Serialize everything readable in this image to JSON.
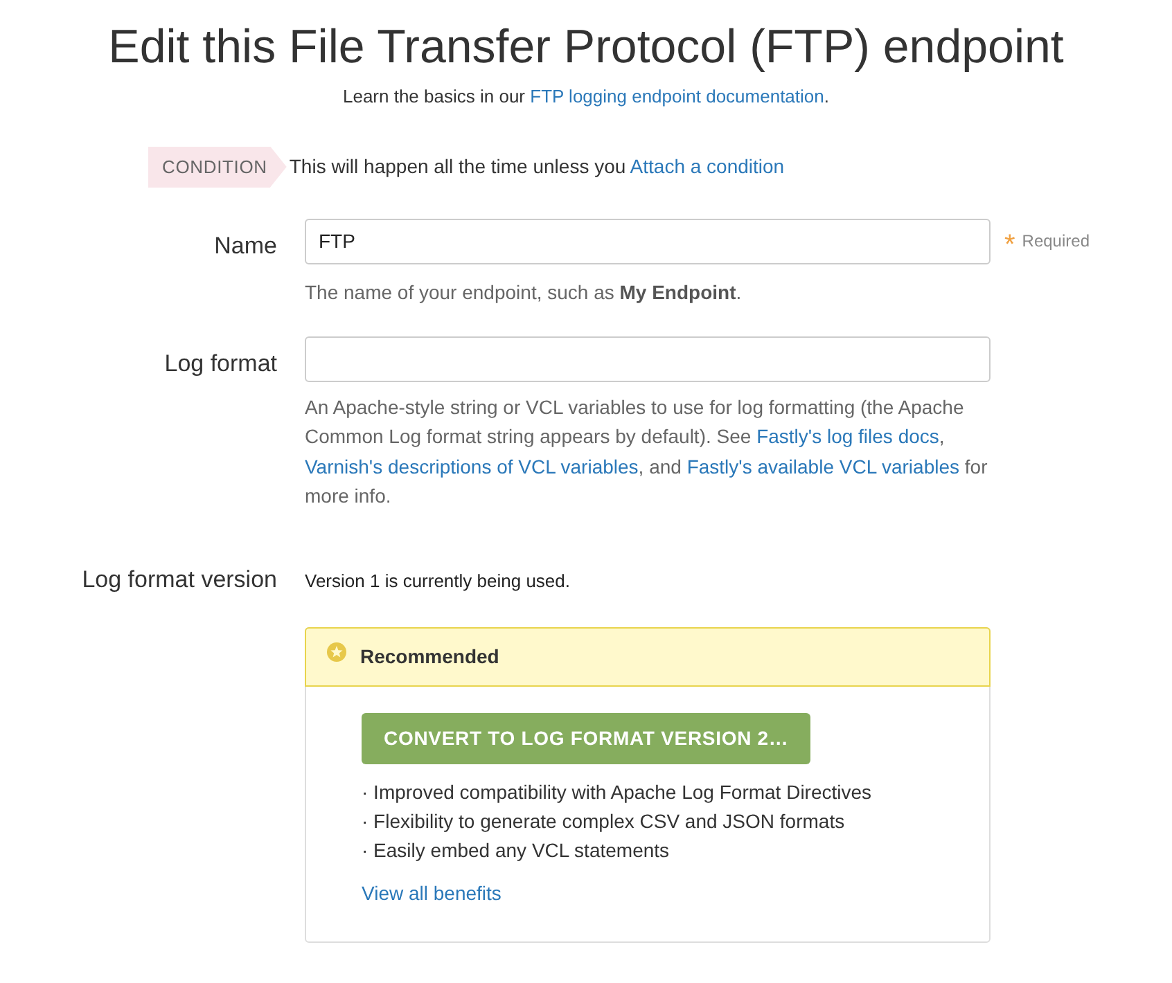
{
  "title": "Edit this File Transfer Protocol (FTP) endpoint",
  "subtitle": [
    {
      "kind": "text",
      "text": "Learn the basics in our "
    },
    {
      "kind": "link",
      "text": "FTP logging endpoint documentation"
    },
    {
      "kind": "text",
      "text": "."
    }
  ],
  "condition": {
    "tag": "CONDITION",
    "text": [
      {
        "kind": "text",
        "text": "This will happen all the time unless you "
      },
      {
        "kind": "link",
        "text": "Attach a condition"
      }
    ]
  },
  "name_field": {
    "label": "Name",
    "value": "FTP",
    "required_mark": "*",
    "required_text": "Required",
    "help": [
      {
        "kind": "text",
        "text": "The name of your endpoint, such as "
      },
      {
        "kind": "bold",
        "text": "My Endpoint"
      },
      {
        "kind": "text",
        "text": "."
      }
    ]
  },
  "log_format_field": {
    "label": "Log format",
    "help": [
      {
        "kind": "text",
        "text": "An Apache-style string or VCL variables to use for log formatting (the Apache Common Log format string appears by default). See "
      },
      {
        "kind": "link",
        "text": "Fastly's log files docs"
      },
      {
        "kind": "text",
        "text": ", "
      },
      {
        "kind": "link",
        "text": "Varnish's descriptions of VCL variables"
      },
      {
        "kind": "text",
        "text": ", and "
      },
      {
        "kind": "link",
        "text": "Fastly's available VCL variables"
      },
      {
        "kind": "text",
        "text": " for more info."
      }
    ]
  },
  "log_format_version": {
    "label": "Log format version",
    "text": "Version 1 is currently being used."
  },
  "recommended": {
    "title": "Recommended",
    "button": "CONVERT TO LOG FORMAT VERSION 2…",
    "benefits": [
      "· Improved compatibility with Apache Log Format Directives",
      "· Flexibility to generate complex CSV and JSON formats",
      "· Easily embed any VCL statements"
    ],
    "link": "View all benefits"
  }
}
